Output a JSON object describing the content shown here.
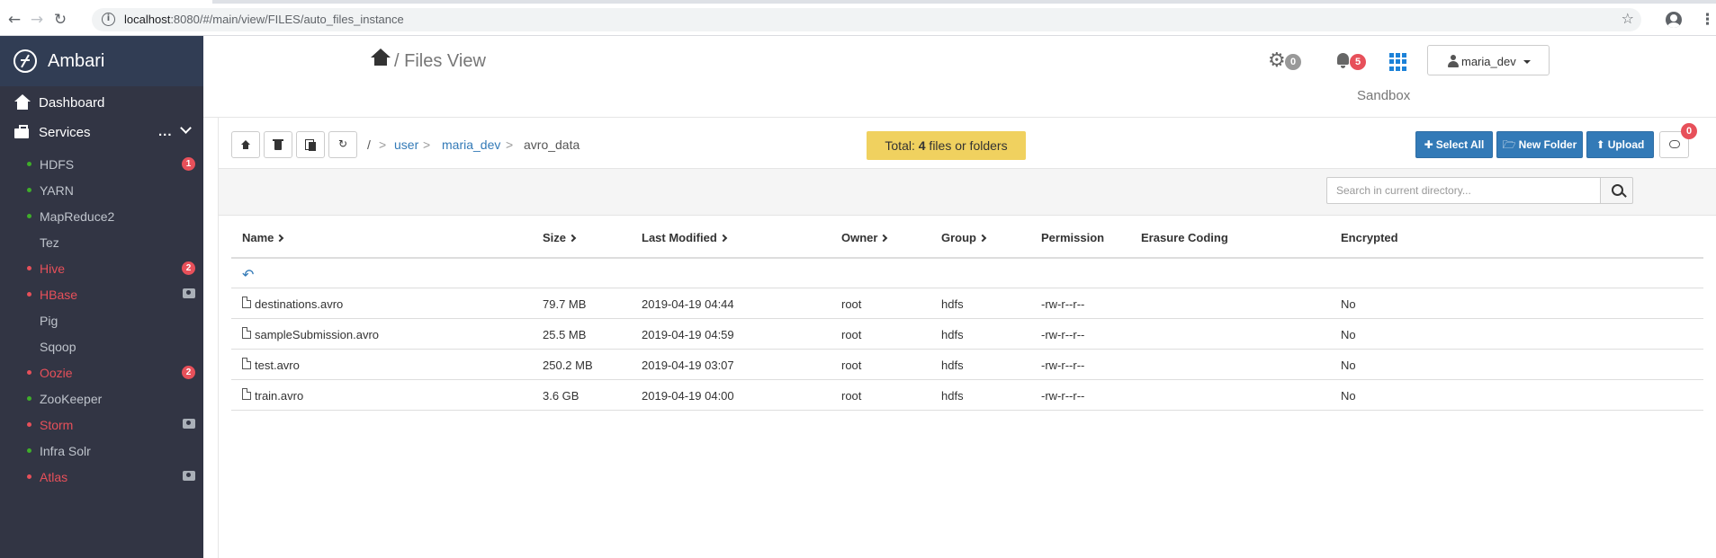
{
  "browser": {
    "url_host": "localhost",
    "url_rest": ":8080/#/main/view/FILES/auto_files_instance",
    "back_icon": "arrow-left",
    "forward_icon": "arrow-right",
    "reload_icon": "reload",
    "star_icon": "star"
  },
  "sidebar": {
    "brand": "Ambari",
    "dashboard": "Dashboard",
    "services_label": "Services",
    "services_more": "...",
    "services": [
      {
        "name": "HDFS",
        "status": "green",
        "badge": "1"
      },
      {
        "name": "YARN",
        "status": "green"
      },
      {
        "name": "MapReduce2",
        "status": "green"
      },
      {
        "name": "Tez",
        "status": "none"
      },
      {
        "name": "Hive",
        "status": "red",
        "badge": "2"
      },
      {
        "name": "HBase",
        "status": "red",
        "maintenance": true
      },
      {
        "name": "Pig",
        "status": "none"
      },
      {
        "name": "Sqoop",
        "status": "none"
      },
      {
        "name": "Oozie",
        "status": "red",
        "badge": "2"
      },
      {
        "name": "ZooKeeper",
        "status": "green"
      },
      {
        "name": "Storm",
        "status": "red",
        "maintenance": true
      },
      {
        "name": "Infra Solr",
        "status": "green"
      },
      {
        "name": "Atlas",
        "status": "red",
        "maintenance": true
      }
    ]
  },
  "header": {
    "separator": "/",
    "title": "Files View",
    "ops_count": "0",
    "alerts_count": "5",
    "user": "maria_dev",
    "cluster": "Sandbox"
  },
  "toolbar": {
    "root": "/",
    "path": [
      "user",
      "maria_dev"
    ],
    "current": "avro_data",
    "path_sep": ">",
    "total_prefix": "Total: ",
    "total_count": "4",
    "total_suffix": " files or folders",
    "select_all": "Select All",
    "new_folder": "New Folder",
    "upload": "Upload",
    "notifications": "0"
  },
  "search": {
    "placeholder": "Search in current directory..."
  },
  "table": {
    "columns": [
      "Name",
      "Size",
      "Last Modified",
      "Owner",
      "Group",
      "Permission",
      "Erasure Coding",
      "Encrypted"
    ],
    "rows": [
      {
        "name": "destinations.avro",
        "size": "79.7 MB",
        "modified": "2019-04-19 04:44",
        "owner": "root",
        "group": "hdfs",
        "permission": "-rw-r--r--",
        "erasure": "",
        "encrypted": "No"
      },
      {
        "name": "sampleSubmission.avro",
        "size": "25.5 MB",
        "modified": "2019-04-19 04:59",
        "owner": "root",
        "group": "hdfs",
        "permission": "-rw-r--r--",
        "erasure": "",
        "encrypted": "No"
      },
      {
        "name": "test.avro",
        "size": "250.2 MB",
        "modified": "2019-04-19 03:07",
        "owner": "root",
        "group": "hdfs",
        "permission": "-rw-r--r--",
        "erasure": "",
        "encrypted": "No"
      },
      {
        "name": "train.avro",
        "size": "3.6 GB",
        "modified": "2019-04-19 04:00",
        "owner": "root",
        "group": "hdfs",
        "permission": "-rw-r--r--",
        "erasure": "",
        "encrypted": "No"
      }
    ]
  },
  "colors": {
    "sidebar_bg": "#323544",
    "brand_bg": "#313d54",
    "primary": "#337ab7",
    "danger": "#e7505a",
    "ok": "#3fae2a",
    "total_bg": "#f0d15f"
  }
}
